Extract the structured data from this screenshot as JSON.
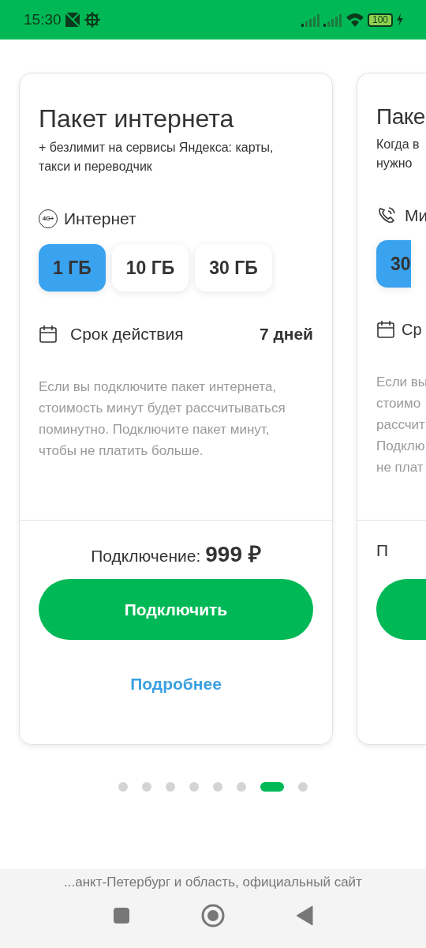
{
  "status_bar": {
    "time": "15:30",
    "battery": "100"
  },
  "cards": [
    {
      "title": "Пакет интернета",
      "subtitle": [
        "+ безлимит на сервисы Яндекса: карты,",
        "такси и переводчик"
      ],
      "section": {
        "kind": "internet",
        "badge": "4G+",
        "label": "Интернет"
      },
      "options": [
        {
          "label": "1 ГБ",
          "selected": true
        },
        {
          "label": "10 ГБ",
          "selected": false
        },
        {
          "label": "30 ГБ",
          "selected": false
        }
      ],
      "period": {
        "label": "Срок действия",
        "value": "7 дней"
      },
      "description": [
        "Если вы подключите пакет интернета,",
        "стоимость минут будет рассчитываться",
        "поминутно. Подключите пакет минут,",
        "чтобы не платить больше."
      ],
      "price": {
        "label": "Подключение:",
        "value": "999 ₽"
      },
      "button": "Подключить",
      "link": "Подробнее"
    },
    {
      "title": "Паке",
      "subtitle": [
        "Когда в",
        "нужно"
      ],
      "section": {
        "kind": "minutes",
        "label": "Ми"
      },
      "options": [
        {
          "label": "30",
          "selected": true
        }
      ],
      "period": {
        "label": "Ср"
      },
      "description": [
        "Если вы",
        "стоимо",
        "рассчит",
        "Подклю",
        "не плат"
      ],
      "price": {
        "label": "П"
      }
    }
  ],
  "pager": [
    {
      "selected": false
    },
    {
      "selected": false
    },
    {
      "selected": false
    },
    {
      "selected": false
    },
    {
      "selected": false
    },
    {
      "selected": false
    },
    {
      "selected": true
    },
    {
      "selected": false
    }
  ],
  "browser_footer": {
    "url": "...анкт-Петербург и область, официальный сайт"
  }
}
